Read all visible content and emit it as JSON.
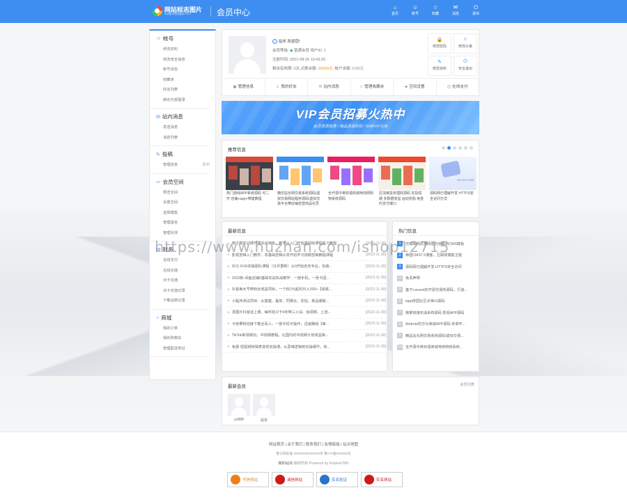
{
  "header": {
    "logo_title": "网站标志图片",
    "logo_sub": "可放置本站的图标LOGO",
    "page_title": "会员中心",
    "nav": [
      {
        "label": "首页",
        "icon": "home-icon",
        "glyph": "⌂"
      },
      {
        "label": "帐号",
        "icon": "user-icon",
        "glyph": "☺"
      },
      {
        "label": "收藏",
        "icon": "star-icon",
        "glyph": "☆"
      },
      {
        "label": "消息",
        "icon": "mail-icon",
        "glyph": "✉"
      },
      {
        "label": "退出",
        "icon": "power-icon",
        "glyph": "⏻"
      }
    ]
  },
  "sidebar": [
    {
      "title": "帐号",
      "icon": "user-icon",
      "glyph": "☺",
      "items": [
        "修改资料",
        "修改安全信息",
        "帐号状态",
        "收藏夹",
        "好友列表",
        "绑定外部登录"
      ]
    },
    {
      "title": "站内消息",
      "icon": "message-icon",
      "glyph": "✉",
      "items": [
        "发送消息",
        "消息列表"
      ]
    },
    {
      "title": "投稿",
      "icon": "pen-icon",
      "glyph": "✎",
      "items": [
        "管理信息"
      ],
      "extra": "发布"
    },
    {
      "title": "会员空间",
      "icon": "monitor-icon",
      "glyph": "▭",
      "items": [
        "预览空间",
        "设置空间",
        "选择模板",
        "管理留言",
        "管理反馈"
      ]
    },
    {
      "title": "财务",
      "icon": "wallet-icon",
      "glyph": "▤",
      "items": [
        "在线支付",
        "在线充值",
        "点卡充值",
        "点卡充值记录",
        "下载消费记录"
      ]
    },
    {
      "title": "商城",
      "icon": "cart-icon",
      "glyph": "⌂",
      "items": [
        "我的订单",
        "我的购物车",
        "管理配送地址"
      ]
    }
  ],
  "profile": {
    "hello": "站长 欢迎您!",
    "level_label": "会员等级:",
    "level_value": "普通会员",
    "uid": "用户ID: 1",
    "reg_label": "注册时间:",
    "reg_value": "2021-08-26 10:43:26",
    "points_prefix": "剩余有效期: 0天,",
    "points_label": "点数余额:",
    "points_value": "99999点",
    "money_label": ", 帐户余额:",
    "money_value": "0.00元",
    "quick_buttons": [
      {
        "label": "修改密码",
        "icon": "lock-icon",
        "glyph": "🔒"
      },
      {
        "label": "修改头像",
        "icon": "avatar-icon",
        "glyph": "☺"
      },
      {
        "label": "修改资料",
        "icon": "edit-icon",
        "glyph": "✎"
      },
      {
        "label": "安全退出",
        "icon": "power-icon",
        "glyph": "⏻"
      }
    ],
    "tabs": [
      {
        "label": "管理信息",
        "glyph": "▣"
      },
      {
        "label": "我的好友",
        "glyph": "☺"
      },
      {
        "label": "站内消息",
        "glyph": "✉"
      },
      {
        "label": "管理收藏夹",
        "glyph": "☆"
      },
      {
        "label": "空间设置",
        "glyph": "◈"
      },
      {
        "label": "在线支付",
        "glyph": "◫"
      }
    ]
  },
  "banner": {
    "title": "VIP会员招募火热中",
    "subtitle": "会员资源免费 / 精品资源折扣 / 99新VIP头衔"
  },
  "recommend": {
    "title": "推荐信息",
    "dots": 6,
    "active_dot": 1,
    "items": [
      {
        "caption": "热门游戏APP系统源码 可二开 店铺+app+带建教程",
        "colors": [
          "#3a3f48",
          "#d94b3d",
          "#f3d5c0"
        ]
      },
      {
        "caption": "精仿站长网交易系统源码/虚拟交易网站程序源码/虚拟交易平台带店铺自营商品社员",
        "colors": [
          "#ffffff",
          "#3d8ef0",
          "#ffb74d"
        ]
      },
      {
        "caption": "全开源中英双语商城电商网购物系统源码",
        "colors": [
          "#ffffff",
          "#e91e63",
          "#7c4dff"
        ]
      },
      {
        "caption": "区块链投资理财源码 定投短期 多数据收益 运动奖励 免签约支付接口",
        "colors": [
          "#f5f1e8",
          "#e94b2c",
          "#40a040"
        ]
      },
      {
        "caption": "源码网已理解开发 HTTPS安全访问方式",
        "colors": [
          "#eef4ff",
          "#9fb8f0",
          "#7b8cde"
        ]
      }
    ],
    "no_picture": "NO PICTURE"
  },
  "news": {
    "title": "最新信息",
    "rows": [
      {
        "text": "架子鼓实训课开课实战演练，教学从入门开始基础班课程练习教程",
        "date": "[2023-11-30]"
      },
      {
        "text": "影视剪辑入门教学，零基础剪辑从零开始学习视频剪辑教程课程",
        "date": "[2023-11-30]"
      },
      {
        "text": "抖元·FHS实操团队课程（11月更新）从0开始走向专业，包装...",
        "date": "[2023-11-30]"
      },
      {
        "text": "2022新·闲鱼店铺0基础实战实战教学：一部手机，一张卡团...",
        "date": "[2023-11-30]"
      },
      {
        "text": "抖音美女号带粉丝收益项目，一个粉2元起的日入300+【保底...",
        "date": "[2023-11-30]"
      },
      {
        "text": "小程序测试项目：从搭建、赢奖、同赛云、实拍、单品爆破...",
        "date": "[2023-11-30]"
      },
      {
        "text": "发图片抖音话上课，每时前只卡4年带三入设、给视频、上流...",
        "date": "[2023-11-30]"
      },
      {
        "text": "卡用果特池接下载全百人，一部手机可操作，迅速赚钱【审...",
        "date": "[2023-11-30]"
      },
      {
        "text": "TikTok新视频玩，中视频教程，比国内的中视频计划收益高...",
        "date": "[2023-11-30]"
      },
      {
        "text": "免费·短视频特殊表变现实操课，从思维逻辑到实操细节，体...",
        "date": "[2023-11-30]"
      }
    ]
  },
  "hot": {
    "title": "热门信息",
    "rows": [
      "仿模板网风格网站内容系统CMS模板",
      "帝国CMS7.5博客，互联网博客主题",
      "源码网已理解开发 HTTPS安全访问",
      "免责声明",
      "基于Laravel的开源交易所源码，打造...",
      "iapp校园社区点单UI源码",
      "微擎钱接实战系统源码 影视APP源码",
      "Android仿华为商城APP源码 安卓开...",
      "精品站长网交易系统源码/虚拟交易...",
      "全开源中英双语商城电商购物系统..."
    ]
  },
  "members": {
    "title": "最新会员",
    "more": "会员列表",
    "list": [
      "yc888",
      "站长"
    ]
  },
  "watermark": "https://www.huzhan.com/ishop12715",
  "footer": {
    "links": "网站首页 | 关于我们 | 联系我们 | 友情链接 | 站点地图",
    "icp": "鲁公网安备 00000000000000号 鲁ICP备000000号",
    "copy_site": "我的站点",
    "copy_rest": "版权所有 Powered by EmpireCMS",
    "badges": [
      {
        "label": "可信网站",
        "color": "#e98020"
      },
      {
        "label": "诚信网站",
        "color": "#cc1b1b"
      },
      {
        "label": "实名验证",
        "color": "#2a74c9"
      },
      {
        "label": "实名网站",
        "color": "#cc1b1b"
      }
    ]
  }
}
